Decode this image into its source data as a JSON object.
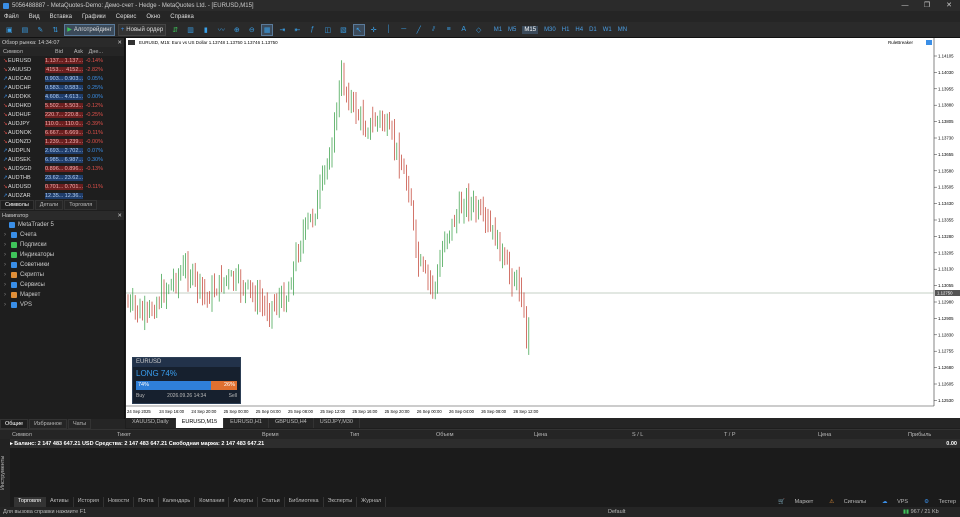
{
  "window": {
    "title": "5056488887 - MetaQuotes-Demo: Демо-счет - Hedge - MetaQuotes Ltd. - [EURUSD,M15]",
    "buttons": [
      "—",
      "❐",
      "✕"
    ]
  },
  "menu": [
    "Файл",
    "Вид",
    "Вставка",
    "Графики",
    "Сервис",
    "Окно",
    "Справка"
  ],
  "toolbar": {
    "algo_label": "Алготрейдинг",
    "new_order_label": "Новый ордер",
    "timeframes": [
      "M1",
      "M5",
      "M15",
      "M30",
      "H1",
      "H4",
      "D1",
      "W1",
      "MN"
    ],
    "active_tf": "M15"
  },
  "market_watch": {
    "title": "Обзор рынка: 14:34:07",
    "columns": [
      "Символ",
      "Bid",
      "Ask",
      "Дне..."
    ],
    "rows": [
      {
        "symbol": "EURUSD",
        "bid": "1.137...",
        "ask": "1.137...",
        "chg": "-0.14%",
        "dir": "neg"
      },
      {
        "symbol": "XAUUSD",
        "bid": "4153...",
        "ask": "4152...",
        "chg": "-2.82%",
        "dir": "neg"
      },
      {
        "symbol": "AUDCAD",
        "bid": "0.903...",
        "ask": "0.903...",
        "chg": "0.05%",
        "dir": "pos"
      },
      {
        "symbol": "AUDCHF",
        "bid": "0.583...",
        "ask": "0.583...",
        "chg": "0.25%",
        "dir": "pos"
      },
      {
        "symbol": "AUDDKK",
        "bid": "4.608...",
        "ask": "4.613...",
        "chg": "0.00%",
        "dir": "pos"
      },
      {
        "symbol": "AUDHKD",
        "bid": "5.502...",
        "ask": "5.503...",
        "chg": "-0.12%",
        "dir": "neg"
      },
      {
        "symbol": "AUDHUF",
        "bid": "220.7...",
        "ask": "220.8...",
        "chg": "-0.25%",
        "dir": "neg"
      },
      {
        "symbol": "AUDJPY",
        "bid": "110.0...",
        "ask": "110.0...",
        "chg": "-0.39%",
        "dir": "neg"
      },
      {
        "symbol": "AUDNOK",
        "bid": "6.667...",
        "ask": "6.669...",
        "chg": "-0.11%",
        "dir": "neg"
      },
      {
        "symbol": "AUDNZD",
        "bid": "1.239...",
        "ask": "1.239...",
        "chg": "-0.00%",
        "dir": "neg"
      },
      {
        "symbol": "AUDPLN",
        "bid": "2.693...",
        "ask": "2.702...",
        "chg": "0.07%",
        "dir": "pos"
      },
      {
        "symbol": "AUDSEK",
        "bid": "6.985...",
        "ask": "6.987...",
        "chg": "0.30%",
        "dir": "pos"
      },
      {
        "symbol": "AUDSGD",
        "bid": "0.896...",
        "ask": "0.896...",
        "chg": "-0.13%",
        "dir": "neg"
      },
      {
        "symbol": "AUDTHB",
        "bid": "23.62...",
        "ask": "23.62...",
        "chg": "",
        "dir": "pos"
      },
      {
        "symbol": "AUDUSD",
        "bid": "0.701...",
        "ask": "0.701...",
        "chg": "-0.11%",
        "dir": "neg"
      },
      {
        "symbol": "AUDZAR",
        "bid": "12.35...",
        "ask": "12.36...",
        "chg": "",
        "dir": "pos"
      }
    ],
    "tabs": [
      "Символы",
      "Детали",
      "Торговля"
    ]
  },
  "navigator": {
    "title": "Навигатор",
    "items": [
      {
        "label": "MetaTrader 5",
        "color": "#3a8ee6"
      },
      {
        "label": "Счета",
        "color": "#3a8ee6"
      },
      {
        "label": "Подписки",
        "color": "#3fc35a"
      },
      {
        "label": "Индикаторы",
        "color": "#3fc35a"
      },
      {
        "label": "Советники",
        "color": "#3a8ee6"
      },
      {
        "label": "Скрипты",
        "color": "#e0903a"
      },
      {
        "label": "Сервисы",
        "color": "#3a8ee6"
      },
      {
        "label": "Маркет",
        "color": "#e0903a"
      },
      {
        "label": "VPS",
        "color": "#3a8ee6"
      }
    ],
    "tabs": [
      "Общие",
      "Избранное",
      "Чаты"
    ]
  },
  "chart": {
    "header": "EURUSD, M15:  Euro vs US Dollar  1.13748 1.13750 1.13746 1.13750",
    "ea_label": "RuleBreaker",
    "price_ticks": [
      "1.14105",
      "1.14030",
      "1.13955",
      "1.13880",
      "1.13805",
      "1.13730",
      "1.13655",
      "1.13580",
      "1.13505",
      "1.13430",
      "1.13355",
      "1.13280",
      "1.13205",
      "1.13130",
      "1.13055",
      "1.12980",
      "1.12905",
      "1.12830",
      "1.12755",
      "1.12680",
      "1.12605",
      "1.12530"
    ],
    "current_price": "1.12750",
    "time_ticks": [
      "24 Sep 2025",
      "24 Sep 16:00",
      "24 Sep 20:00",
      "25 Sep 00:00",
      "25 Sep 04:00",
      "25 Sep 08:00",
      "25 Sep 12:00",
      "25 Sep 16:00",
      "25 Sep 20:00",
      "26 Sep 00:00",
      "26 Sep 04:00",
      "26 Sep 08:00",
      "26 Sep 12:00"
    ]
  },
  "widget": {
    "symbol": "EURUSD",
    "direction": "LONG",
    "pct_text": "74%",
    "buy_pct": "74%",
    "sell_pct": "26%",
    "buy_share": 0.74,
    "buy": "Buy",
    "sell": "Sell",
    "time": "2026.09.26 14:34"
  },
  "chart_tabs": [
    "XAUUSD,Daily",
    "EURUSD,M15",
    "EURUSD,H1",
    "GBPUSD,H4",
    "USDJPY,M30"
  ],
  "toolbox": {
    "columns": [
      "Символ",
      "Тикет",
      "Время",
      "Тип",
      "Объем",
      "Цена",
      "S / L",
      "T / P",
      "Цена",
      "Прибыль"
    ],
    "balance": "Баланс: 2 147 483 647.21 USD  Средства: 2 147 483 647.21  Свободная маржа: 2 147 483 647.21",
    "balance_value": "0.00",
    "side_label": "Инструменты",
    "tabs": [
      "Торговля",
      "Активы",
      "История",
      "Новости",
      "Почта",
      "Календарь",
      "Компания",
      "Алерты",
      "Статьи",
      "Библиотека",
      "Эксперты",
      "Журнал"
    ],
    "right_items": [
      "Маркет",
      "Сигналы",
      "VPS",
      "Тестер"
    ]
  },
  "status": {
    "help": "Для вызова справки нажмите F1",
    "profile": "Default",
    "traffic": "967 / 21 Kb"
  }
}
